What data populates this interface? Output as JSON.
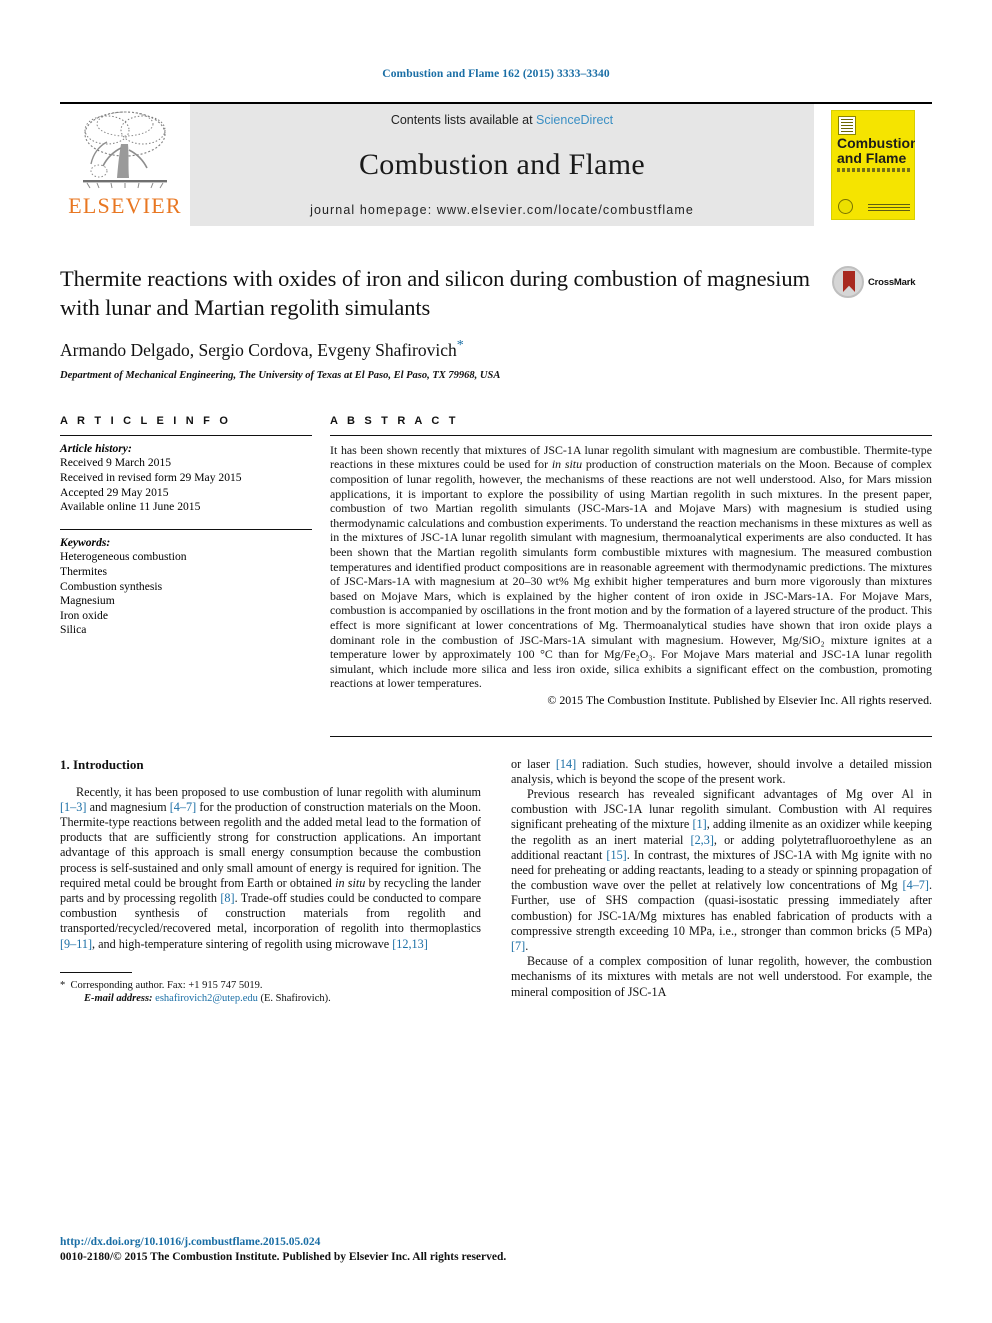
{
  "running_head": "Combustion and Flame 162 (2015) 3333–3340",
  "masthead": {
    "publisher_wordmark": "ELSEVIER",
    "contents_prefix": "Contents lists available at ",
    "contents_link": "ScienceDirect",
    "journal_name": "Combustion and Flame",
    "homepage_line": "journal homepage: www.elsevier.com/locate/combustflame",
    "cover": {
      "title_line1": "Combustion",
      "title_line2": "and Flame"
    }
  },
  "article": {
    "title": "Thermite reactions with oxides of iron and silicon during combustion of magnesium with lunar and Martian regolith simulants",
    "authors": "Armando Delgado, Sergio Cordova, Evgeny Shafirovich",
    "corresponding_marker": "*",
    "affiliation": "Department of Mechanical Engineering, The University of Texas at El Paso, El Paso, TX 79968, USA",
    "crossmark_label": "CrossMark"
  },
  "article_info": {
    "heading": "A R T I C L E   I N F O",
    "history_label": "Article history:",
    "history": [
      "Received 9 March 2015",
      "Received in revised form 29 May 2015",
      "Accepted 29 May 2015",
      "Available online 11 June 2015"
    ],
    "keywords_label": "Keywords:",
    "keywords": [
      "Heterogeneous combustion",
      "Thermites",
      "Combustion synthesis",
      "Magnesium",
      "Iron oxide",
      "Silica"
    ]
  },
  "abstract": {
    "heading": "A B S T R A C T",
    "part1": "It has been shown recently that mixtures of JSC-1A lunar regolith simulant with magnesium are combustible. Thermite-type reactions in these mixtures could be used for ",
    "insitu1": "in situ",
    "part2": " production of construction materials on the Moon. Because of complex composition of lunar regolith, however, the mechanisms of these reactions are not well understood. Also, for Mars mission applications, it is important to explore the possibility of using Martian regolith in such mixtures. In the present paper, combustion of two Martian regolith simulants (JSC-Mars-1A and Mojave Mars) with magnesium is studied using thermodynamic calculations and combustion experiments. To understand the reaction mechanisms in these mixtures as well as in the mixtures of JSC-1A lunar regolith simulant with magnesium, thermoanalytical experiments are also conducted. It has been shown that the Martian regolith simulants form combustible mixtures with magnesium. The measured combustion temperatures and identified product compositions are in reasonable agreement with thermodynamic predictions. The mixtures of JSC-Mars-1A with magnesium at 20–30 wt% Mg exhibit higher temperatures and burn more vigorously than mixtures based on Mojave Mars, which is explained by the higher content of iron oxide in JSC-Mars-1A. For Mojave Mars, combustion is accompanied by oscillations in the front motion and by the formation of a layered structure of the product. This effect is more significant at lower concentrations of Mg. Thermoanalytical studies have shown that iron oxide plays a dominant role in the combustion of JSC-Mars-1A simulant with magnesium. However, Mg/SiO₂ mixture ignites at a temperature lower by approximately 100 °C than for Mg/Fe₂O₃. For Mojave Mars material and JSC-1A lunar regolith simulant, which include more silica and less iron oxide, silica exhibits a significant effect on the combustion, promoting reactions at lower temperatures.",
    "copyright": "© 2015 The Combustion Institute. Published by Elsevier Inc. All rights reserved."
  },
  "introduction": {
    "heading": "1. Introduction",
    "left_p1_a": "Recently, it has been proposed to use combustion of lunar regolith with aluminum ",
    "left_ref1": "[1–3]",
    "left_p1_b": " and magnesium ",
    "left_ref2": "[4–7]",
    "left_p1_c": " for the production of construction materials on the Moon. Thermite-type reactions between regolith and the added metal lead to the formation of products that are sufficiently strong for construction applications. An important advantage of this approach is small energy consumption because the combustion process is self-sustained and only small amount of energy is required for ignition. The required metal could be brought from Earth or obtained ",
    "insitu": "in situ",
    "left_p1_d": " by recycling the lander parts and by processing regolith ",
    "left_ref3": "[8]",
    "left_p1_e": ". Trade-off studies could be conducted to compare combustion synthesis of construction materials from regolith and transported/recycled/recovered metal, incorporation of regolith into thermoplastics ",
    "left_ref4": "[9–11]",
    "left_p1_f": ", and high-temperature sintering of regolith using microwave ",
    "left_ref5": "[12,13]",
    "right_p1_a": "or laser ",
    "right_ref1": "[14]",
    "right_p1_b": " radiation. Such studies, however, should involve a detailed mission analysis, which is beyond the scope of the present work.",
    "right_p2_a": "Previous research has revealed significant advantages of Mg over Al in combustion with JSC-1A lunar regolith simulant. Combustion with Al requires significant preheating of the mixture ",
    "right_ref2": "[1]",
    "right_p2_b": ", adding ilmenite as an oxidizer while keeping the regolith as an inert material ",
    "right_ref3": "[2,3]",
    "right_p2_c": ", or adding polytetrafluoroethylene as an additional reactant ",
    "right_ref4": "[15]",
    "right_p2_d": ". In contrast, the mixtures of JSC-1A with Mg ignite with no need for preheating or adding reactants, leading to a steady or spinning propagation of the combustion wave over the pellet at relatively low concentrations of Mg ",
    "right_ref5": "[4–7]",
    "right_p2_e": ". Further, use of SHS compaction (quasi-isostatic pressing immediately after combustion) for JSC-1A/Mg mixtures has enabled fabrication of products with a compressive strength exceeding 10 MPa, i.e., stronger than common bricks (5 MPa) ",
    "right_ref6": "[7]",
    "right_p2_f": ".",
    "right_p3": "Because of a complex composition of lunar regolith, however, the combustion mechanisms of its mixtures with metals are not well understood. For example, the mineral composition of JSC-1A"
  },
  "footnote": {
    "marker": "*",
    "corresponding": "Corresponding author. Fax: +1 915 747 5019.",
    "email_label": "E-mail address:",
    "email": "eshafirovich2@utep.edu",
    "email_suffix": " (E. Shafirovich)."
  },
  "page_footer": {
    "doi": "http://dx.doi.org/10.1016/j.combustflame.2015.05.024",
    "issn_line": "0010-2180/© 2015 The Combustion Institute. Published by Elsevier Inc. All rights reserved."
  },
  "colors": {
    "link_blue": "#1a6ea5",
    "elsevier_orange": "#E87722",
    "cover_yellow": "#f5e400",
    "band_grey": "#e6e6e6"
  }
}
